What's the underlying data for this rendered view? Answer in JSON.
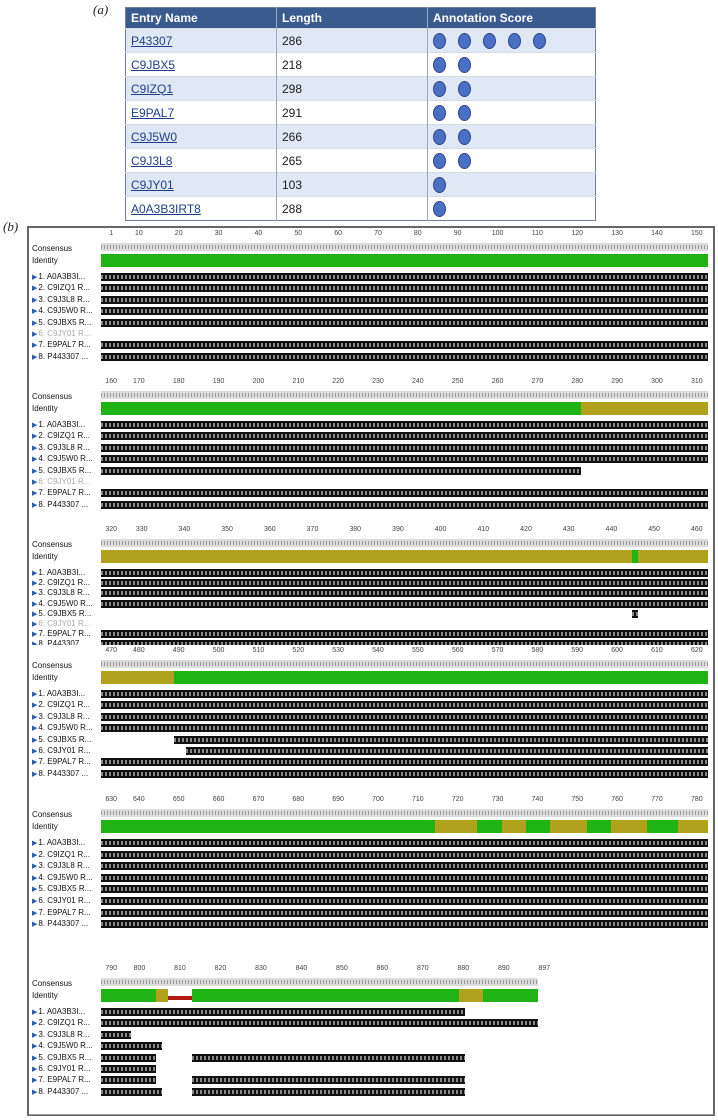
{
  "panel_a": {
    "label": "(a)",
    "headers": {
      "entry_name": "Entry Name",
      "length": "Length",
      "annotation_score": "Annotation Score"
    },
    "rows": [
      {
        "entry": "P43307",
        "length": "286",
        "score": 5
      },
      {
        "entry": "C9JBX5",
        "length": "218",
        "score": 2
      },
      {
        "entry": "C9IZQ1",
        "length": "298",
        "score": 2
      },
      {
        "entry": "E9PAL7",
        "length": "291",
        "score": 2
      },
      {
        "entry": "C9J5W0",
        "length": "266",
        "score": 2
      },
      {
        "entry": "C9J3L8",
        "length": "265",
        "score": 2
      },
      {
        "entry": "C9JY01",
        "length": "103",
        "score": 1
      },
      {
        "entry": "A0A3B3IRT8",
        "length": "288",
        "score": 1
      }
    ]
  },
  "panel_b": {
    "label": "(b)",
    "consensus_label": "Consensus",
    "identity_label": "Identity",
    "sequences": [
      "1. A0A3B3I...",
      "2. C9IZQ1 R...",
      "3. C9J3L8 R...",
      "4. C9J5W0 R...",
      "5. C9JBX5 R...",
      "6. C9JY01 R...",
      "7. E9PAL7 R...",
      "8. P443307 ..."
    ],
    "colors": {
      "identity_high": "#1fb314",
      "identity_mid": "#b0a21c",
      "identity_low": "#b2190f"
    },
    "blocks": [
      {
        "ticks": [
          "1",
          "10",
          "20",
          "30",
          "40",
          "50",
          "60",
          "70",
          "80",
          "90",
          "100",
          "110",
          "120",
          "130",
          "140",
          "150"
        ],
        "identity": [
          {
            "s": 0,
            "e": 1,
            "c": "g"
          }
        ],
        "rows": [
          [
            [
              0,
              1
            ]
          ],
          [
            [
              0,
              1
            ]
          ],
          [
            [
              0,
              1
            ]
          ],
          [
            [
              0,
              1
            ]
          ],
          [
            [
              0,
              1
            ]
          ],
          [],
          [
            [
              0,
              1
            ]
          ],
          [
            [
              0,
              1
            ]
          ]
        ],
        "greyed": [
          5
        ]
      },
      {
        "ticks": [
          "160",
          "170",
          "180",
          "190",
          "200",
          "210",
          "220",
          "230",
          "240",
          "250",
          "260",
          "270",
          "280",
          "290",
          "300",
          "310"
        ],
        "identity": [
          {
            "s": 0,
            "e": 0.79,
            "c": "g"
          },
          {
            "s": 0.79,
            "e": 1,
            "c": "y"
          }
        ],
        "rows": [
          [
            [
              0,
              1
            ]
          ],
          [
            [
              0,
              1
            ]
          ],
          [
            [
              0,
              1
            ]
          ],
          [
            [
              0,
              1
            ]
          ],
          [
            [
              0,
              0.79
            ]
          ],
          [],
          [
            [
              0,
              1
            ]
          ],
          [
            [
              0,
              1
            ]
          ]
        ],
        "greyed": [
          5
        ]
      },
      {
        "ticks": [
          "320",
          "330",
          "340",
          "350",
          "360",
          "370",
          "380",
          "390",
          "400",
          "410",
          "420",
          "430",
          "440",
          "450",
          "460"
        ],
        "identity": [
          {
            "s": 0,
            "e": 0.875,
            "c": "y"
          },
          {
            "s": 0.875,
            "e": 0.885,
            "c": "g"
          },
          {
            "s": 0.885,
            "e": 1,
            "c": "y"
          }
        ],
        "rows": [
          [
            [
              0,
              1
            ]
          ],
          [
            [
              0,
              1
            ]
          ],
          [
            [
              0,
              1
            ]
          ],
          [
            [
              0,
              1
            ]
          ],
          [
            [
              0.875,
              0.885
            ]
          ],
          [],
          [
            [
              0,
              1
            ]
          ],
          [
            [
              0,
              1
            ]
          ]
        ],
        "greyed": [
          5
        ]
      },
      {
        "ticks": [
          "470",
          "480",
          "490",
          "500",
          "510",
          "520",
          "530",
          "540",
          "550",
          "560",
          "570",
          "580",
          "590",
          "600",
          "610",
          "620"
        ],
        "identity": [
          {
            "s": 0,
            "e": 0.12,
            "c": "y"
          },
          {
            "s": 0.12,
            "e": 1,
            "c": "g"
          }
        ],
        "rows": [
          [
            [
              0,
              1
            ]
          ],
          [
            [
              0,
              1
            ]
          ],
          [
            [
              0,
              1
            ]
          ],
          [
            [
              0,
              1
            ]
          ],
          [
            [
              0.12,
              1
            ]
          ],
          [
            [
              0.14,
              1
            ]
          ],
          [
            [
              0,
              1
            ]
          ],
          [
            [
              0,
              1
            ]
          ]
        ],
        "greyed": []
      },
      {
        "ticks": [
          "630",
          "640",
          "650",
          "660",
          "670",
          "680",
          "690",
          "700",
          "710",
          "720",
          "730",
          "740",
          "750",
          "760",
          "770",
          "780"
        ],
        "identity": [
          {
            "s": 0,
            "e": 0.5,
            "c": "g"
          },
          {
            "s": 0.5,
            "e": 0.52,
            "c": "g"
          },
          {
            "s": 0.52,
            "e": 0.55,
            "c": "g"
          },
          {
            "s": 0.55,
            "e": 0.62,
            "c": "y"
          },
          {
            "s": 0.62,
            "e": 0.66,
            "c": "g"
          },
          {
            "s": 0.66,
            "e": 0.7,
            "c": "y"
          },
          {
            "s": 0.7,
            "e": 0.74,
            "c": "g"
          },
          {
            "s": 0.74,
            "e": 0.8,
            "c": "y"
          },
          {
            "s": 0.8,
            "e": 0.84,
            "c": "g"
          },
          {
            "s": 0.84,
            "e": 0.9,
            "c": "y"
          },
          {
            "s": 0.9,
            "e": 0.95,
            "c": "g"
          },
          {
            "s": 0.95,
            "e": 1,
            "c": "y"
          }
        ],
        "rows": [
          [
            [
              0,
              1
            ]
          ],
          [
            [
              0,
              1
            ]
          ],
          [
            [
              0,
              1
            ]
          ],
          [
            [
              0,
              1
            ]
          ],
          [
            [
              0,
              1
            ]
          ],
          [
            [
              0,
              1
            ]
          ],
          [
            [
              0,
              1
            ]
          ],
          [
            [
              0,
              1
            ]
          ]
        ],
        "greyed": []
      },
      {
        "ticks": [
          "790",
          "800",
          "810",
          "820",
          "830",
          "840",
          "850",
          "860",
          "870",
          "880",
          "890",
          "897"
        ],
        "identity": [
          {
            "s": 0,
            "e": 0.09,
            "c": "g"
          },
          {
            "s": 0.09,
            "e": 0.11,
            "c": "y"
          },
          {
            "s": 0.11,
            "e": 0.15,
            "c": "r"
          },
          {
            "s": 0.15,
            "e": 0.59,
            "c": "g"
          },
          {
            "s": 0.59,
            "e": 0.63,
            "c": "y"
          },
          {
            "s": 0.63,
            "e": 0.72,
            "c": "g"
          }
        ],
        "rows": [
          [
            [
              0,
              0.6
            ]
          ],
          [
            [
              0,
              0.72
            ]
          ],
          [
            [
              0,
              0.05
            ]
          ],
          [
            [
              0,
              0.1
            ]
          ],
          [
            [
              0,
              0.09
            ],
            [
              0.15,
              0.6
            ]
          ],
          [
            [
              0,
              0.09
            ]
          ],
          [
            [
              0,
              0.09
            ],
            [
              0.15,
              0.6
            ]
          ],
          [
            [
              0,
              0.1
            ],
            [
              0.15,
              0.6
            ]
          ]
        ],
        "greyed": []
      }
    ]
  }
}
